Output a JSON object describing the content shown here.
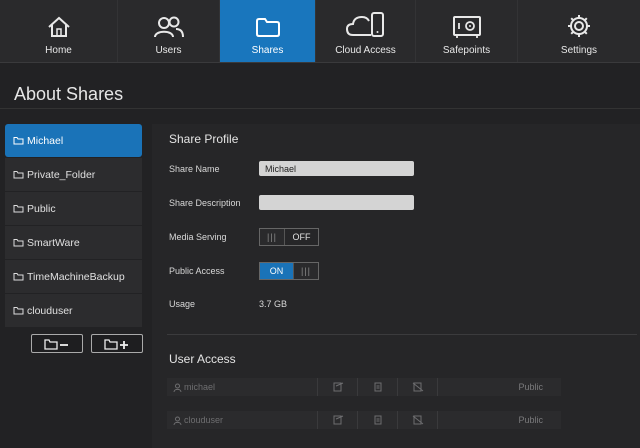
{
  "nav": {
    "items": [
      {
        "label": "Home",
        "icon": "home-icon"
      },
      {
        "label": "Users",
        "icon": "users-icon"
      },
      {
        "label": "Shares",
        "icon": "folder-icon",
        "active": true
      },
      {
        "label": "Cloud Access",
        "icon": "cloud-device-icon"
      },
      {
        "label": "Safepoints",
        "icon": "safe-icon"
      },
      {
        "label": "Settings",
        "icon": "gear-icon"
      }
    ]
  },
  "page": {
    "title": "About Shares"
  },
  "sidebar": {
    "shares": [
      {
        "label": "Michael",
        "active": true
      },
      {
        "label": "Private_Folder"
      },
      {
        "label": "Public"
      },
      {
        "label": "SmartWare"
      },
      {
        "label": "TimeMachineBackup"
      },
      {
        "label": "clouduser"
      }
    ],
    "remove_icon": "folder-minus-icon",
    "add_icon": "folder-plus-icon"
  },
  "profile": {
    "title": "Share Profile",
    "share_name_label": "Share Name",
    "share_name_value": "Michael",
    "share_description_label": "Share Description",
    "share_description_value": "",
    "media_serving_label": "Media Serving",
    "media_serving_state": "OFF",
    "public_access_label": "Public Access",
    "public_access_state": "ON",
    "toggle_grip": "|||",
    "usage_label": "Usage",
    "usage_value": "3.7 GB"
  },
  "user_access": {
    "title": "User Access",
    "users": [
      {
        "name": "michael",
        "access": "Public"
      },
      {
        "name": "clouduser",
        "access": "Public"
      }
    ]
  },
  "colors": {
    "accent": "#1976bd",
    "background": "#222224",
    "panel": "#262628"
  }
}
